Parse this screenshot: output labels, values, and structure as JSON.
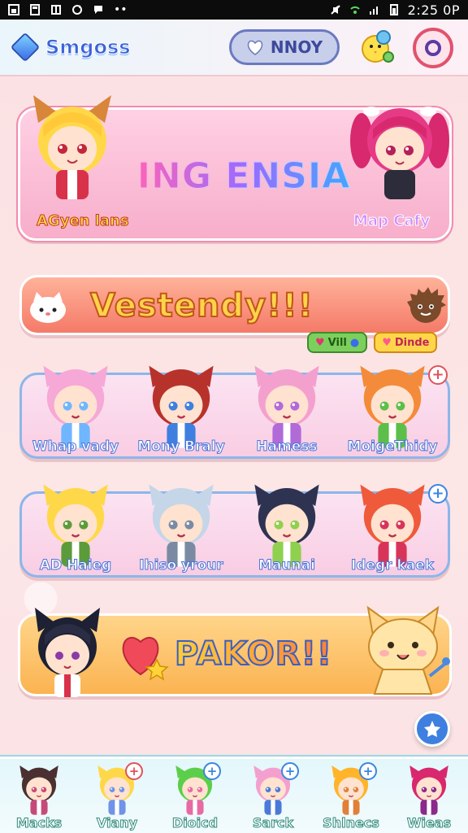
{
  "status_bar": {
    "time": "2:25 0P"
  },
  "header": {
    "logo_text": "Smgoss",
    "mode_label": "NNOY"
  },
  "banners": {
    "featured": {
      "title": "ING ENSIA",
      "left_character": "AGyen lans",
      "right_character": "Map Cafy"
    },
    "event": {
      "title": "Vestendy!!!",
      "badge_green": "Vill",
      "badge_gold": "Dinde"
    },
    "promo": {
      "title": "PAKOR!!"
    }
  },
  "roster_row_1": [
    {
      "name": "Whap vady",
      "hair": "#f6a8d6",
      "accent": "#6fb6ff",
      "plus": false
    },
    {
      "name": "Mony Braly",
      "hair": "#b8322c",
      "accent": "#3f7fe0",
      "plus": false
    },
    {
      "name": "Hamess",
      "hair": "#f4a0cf",
      "accent": "#b06bd8",
      "plus": false
    },
    {
      "name": "MoigeThidy",
      "hair": "#f38b3a",
      "accent": "#5bbf4a",
      "plus": true
    }
  ],
  "roster_row_2": [
    {
      "name": "AD Haieg",
      "hair": "#ffd84a",
      "accent": "#5c9b3a",
      "plus": false
    },
    {
      "name": "Ihiso yrour",
      "hair": "#c4d6e8",
      "accent": "#7b8aa3",
      "plus": false
    },
    {
      "name": "Maunai",
      "hair": "#2e3352",
      "accent": "#8fd04f",
      "plus": false
    },
    {
      "name": "Idegr kaek",
      "hair": "#ef5a3a",
      "accent": "#d8345a",
      "plus": true
    }
  ],
  "bottom_nav": [
    {
      "label": "Macks",
      "hair": "#4a3030",
      "accent": "#c54a7a",
      "plus": false
    },
    {
      "label": "Viany",
      "hair": "#ffd84a",
      "accent": "#6f93e8",
      "plus": true
    },
    {
      "label": "Dioicd",
      "hair": "#5ccf4a",
      "accent": "#e86aa3",
      "plus": true
    },
    {
      "label": "Sarck",
      "hair": "#f4a0cf",
      "accent": "#4a7ad8",
      "plus": true
    },
    {
      "label": "Shlnecs",
      "hair": "#ffb42a",
      "accent": "#e0803a",
      "plus": true
    },
    {
      "label": "Wieas",
      "hair": "#d8286e",
      "accent": "#8a2a8a",
      "plus": false
    }
  ],
  "colors": {
    "accent_pink": "#f28bb0",
    "accent_blue": "#3f7fe0",
    "accent_gold": "#fbb351",
    "accent_coral": "#f47a68"
  },
  "icons": {
    "logo": "diamond-gem-icon",
    "mode": "heart-icon",
    "mascot": "chick-mascot-icon",
    "record": "record-ring-icon",
    "fab": "star-icon"
  }
}
